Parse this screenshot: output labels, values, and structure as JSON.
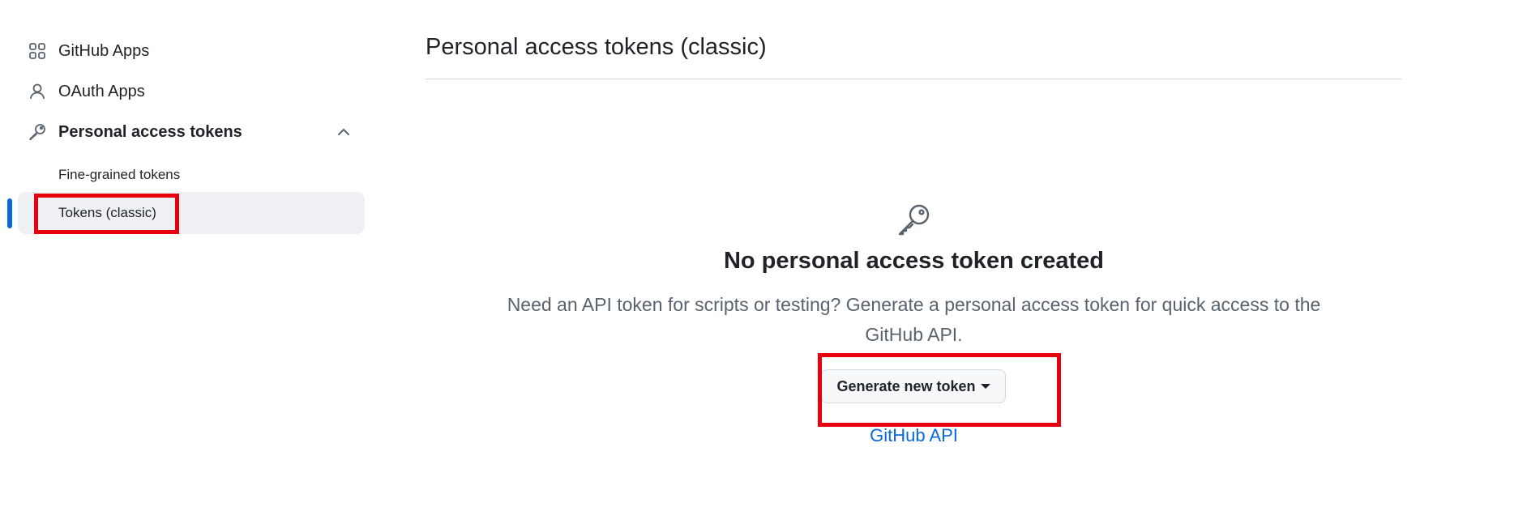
{
  "sidebar": {
    "items": [
      {
        "label": "GitHub Apps",
        "icon": "apps-grid-icon"
      },
      {
        "label": "OAuth Apps",
        "icon": "person-icon"
      },
      {
        "label": "Personal access tokens",
        "icon": "key-icon",
        "expanded": true
      }
    ],
    "sub_items": [
      {
        "label": "Fine-grained tokens",
        "active": false
      },
      {
        "label": "Tokens (classic)",
        "active": true
      }
    ]
  },
  "main": {
    "title": "Personal access tokens (classic)",
    "blankslate": {
      "icon": "key-icon",
      "heading": "No personal access token created",
      "description_line1": "Need an API token for scripts or testing? Generate a personal access token for quick access to the",
      "description_line2": "GitHub API.",
      "button_label": "Generate new token",
      "link_label": "GitHub API"
    }
  },
  "colors": {
    "accent": "#0969da",
    "highlight": "#e8000e",
    "active_bg": "#eef0f3"
  }
}
